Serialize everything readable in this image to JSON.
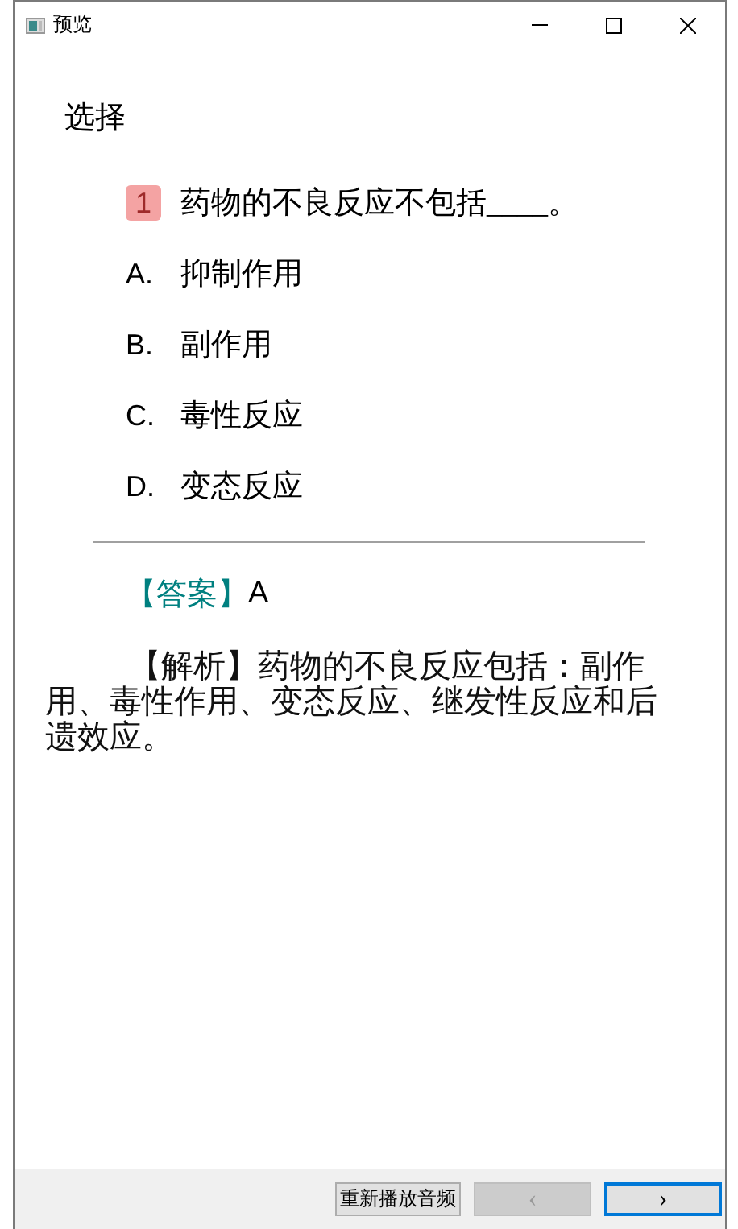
{
  "window": {
    "title": "预览"
  },
  "section_title": "选择",
  "question": {
    "number": "1",
    "text": "药物的不良反应不包括____。"
  },
  "options": [
    {
      "letter": "A.",
      "text": "抑制作用"
    },
    {
      "letter": "B.",
      "text": "副作用"
    },
    {
      "letter": "C.",
      "text": "毒性反应"
    },
    {
      "letter": "D.",
      "text": "变态反应"
    }
  ],
  "answer": {
    "label": "【答案】",
    "value": "A"
  },
  "explanation": "【解析】药物的不良反应包括：副作用、毒性作用、变态反应、继发性反应和后遗效应。",
  "buttons": [
    {
      "kind": "replay",
      "label": "重新播放音频",
      "disabled": false,
      "focused": false
    },
    {
      "kind": "prev",
      "label": "‹",
      "disabled": true,
      "focused": false
    },
    {
      "kind": "next",
      "label": "›",
      "disabled": false,
      "focused": true
    }
  ]
}
